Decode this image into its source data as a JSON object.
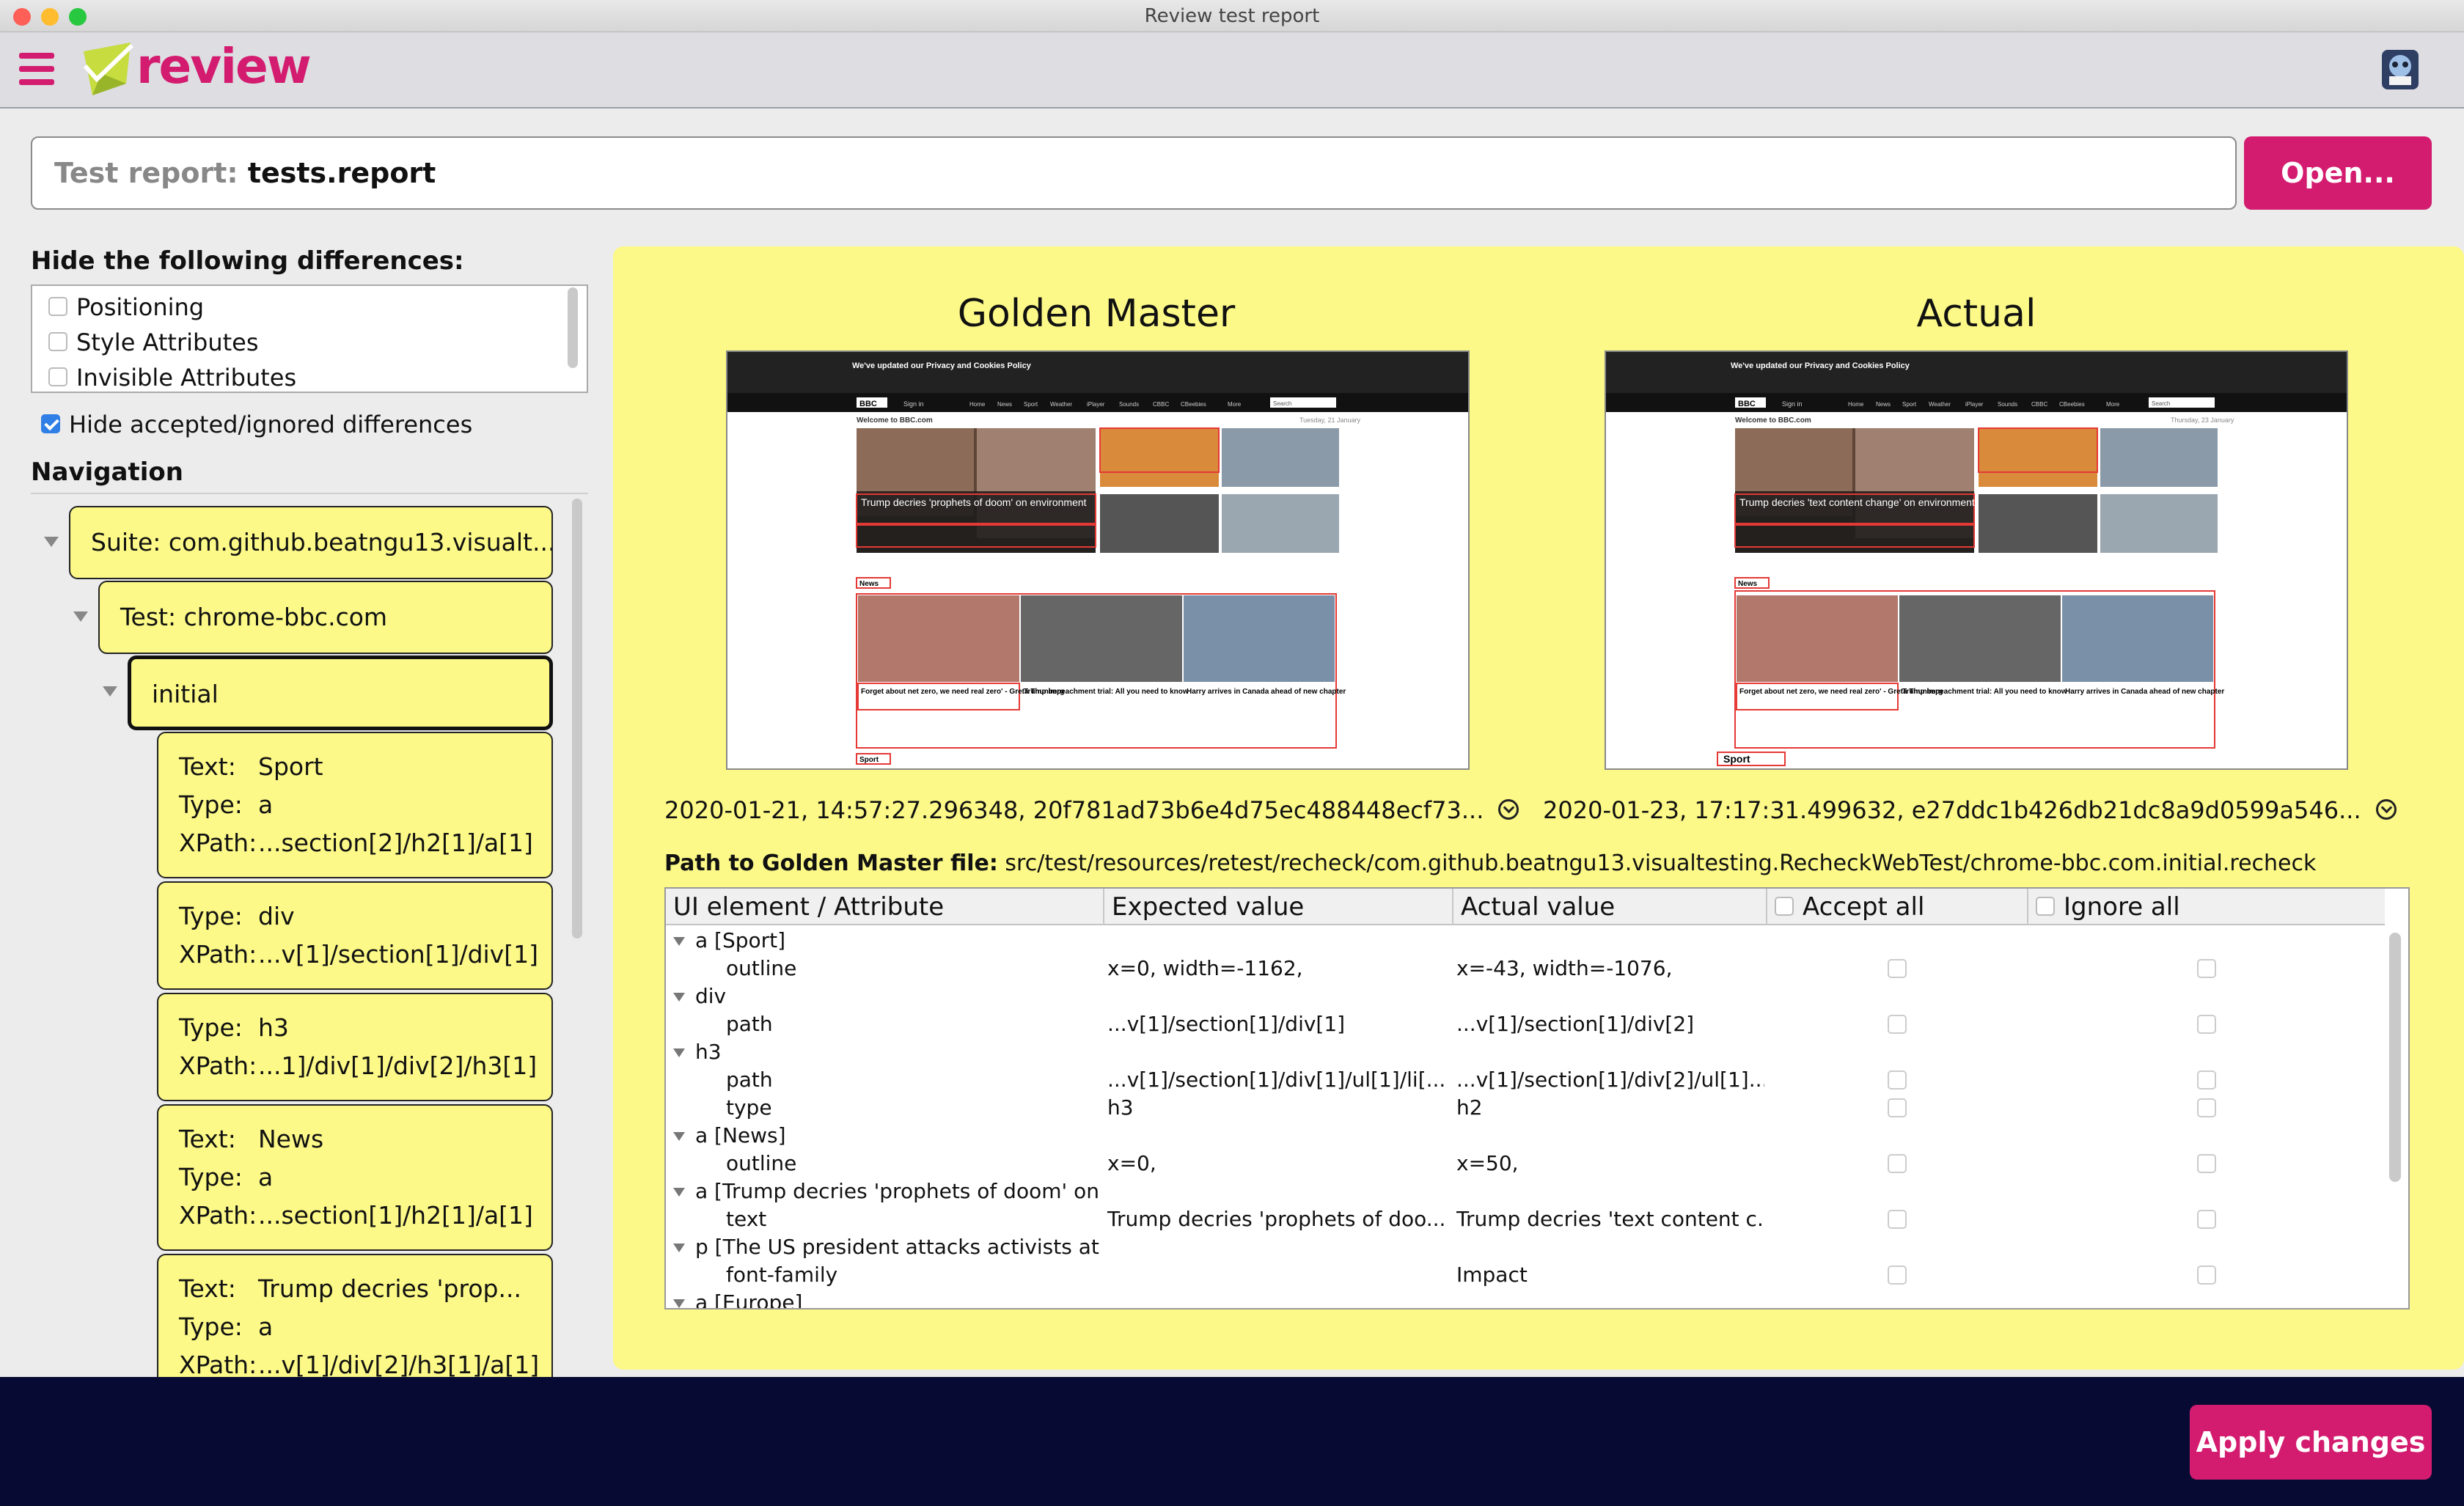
{
  "window": {
    "title": "Review test report"
  },
  "header": {
    "logo_text": "review",
    "brand_color": "#d31c6f",
    "logo_icon": "review-logo-icon",
    "avatar_icon": "user-avatar-icon"
  },
  "report": {
    "label": "Test report:",
    "value": "tests.report",
    "open_label": "Open..."
  },
  "filters": {
    "heading": "Hide the following differences:",
    "items": [
      {
        "label": "Positioning",
        "checked": false
      },
      {
        "label": "Style Attributes",
        "checked": false
      },
      {
        "label": "Invisible Attributes",
        "checked": false
      }
    ],
    "hide_accepted_label": "Hide accepted/ignored differences",
    "hide_accepted_checked": true
  },
  "navigation": {
    "heading": "Navigation",
    "suite": "Suite: com.github.beatngu13.visualt...",
    "test": "Test: chrome-bbc.com",
    "check": "initial",
    "items": [
      {
        "lines": [
          {
            "k": "Text:",
            "v": "Sport"
          },
          {
            "k": "Type:",
            "v": "a"
          },
          {
            "k": "XPath:",
            "v": "...section[2]/h2[1]/a[1]"
          }
        ]
      },
      {
        "lines": [
          {
            "k": "Type:",
            "v": "div"
          },
          {
            "k": "XPath:",
            "v": "...v[1]/section[1]/div[1]"
          }
        ]
      },
      {
        "lines": [
          {
            "k": "Type:",
            "v": "h3"
          },
          {
            "k": "XPath:",
            "v": "...1]/div[1]/div[2]/h3[1]"
          }
        ]
      },
      {
        "lines": [
          {
            "k": "Text:",
            "v": "News"
          },
          {
            "k": "Type:",
            "v": "a"
          },
          {
            "k": "XPath:",
            "v": "...section[1]/h2[1]/a[1]"
          }
        ]
      },
      {
        "lines": [
          {
            "k": "Text:",
            "v": "Trump decries 'prop..."
          },
          {
            "k": "Type:",
            "v": "a"
          },
          {
            "k": "XPath:",
            "v": "...v[1]/div[2]/h3[1]/a[1]"
          }
        ]
      }
    ]
  },
  "comparison": {
    "golden_title": "Golden Master",
    "actual_title": "Actual",
    "golden_info": "2020-01-21, 14:57:27.296348, 20f781ad73b6e4d75ec488448ecf73...",
    "actual_info": "2020-01-23, 17:17:31.499632, e27ddc1b426db21dc8a9d0599a546...",
    "path_label": "Path to Golden Master file:",
    "path_value": "src/test/resources/retest/recheck/com.github.beatngu13.visualtesting.RecheckWebTest/chrome-bbc.com.initial.recheck"
  },
  "screenshot": {
    "banner_title": "We've updated our Privacy and Cookies Policy",
    "bbc_logo": "BBC",
    "sign_in": "Sign in",
    "nav_items": [
      "Home",
      "News",
      "Sport",
      "Weather",
      "iPlayer",
      "Sounds",
      "CBBC",
      "CBeebies",
      "More"
    ],
    "search": "Search",
    "welcome": "Welcome to BBC.com",
    "golden_date": "Tuesday, 21 January",
    "actual_date": "Thursday, 23 January",
    "golden_headline": "Trump decries 'prophets of doom' on environment",
    "actual_headline": "Trump decries 'text content change' on environment",
    "news_label": "News",
    "sport_label": "Sport",
    "story1": "Forget about net zero, we need real zero' - Greta Thunberg",
    "story2": "Trump impeachment trial: All you need to know",
    "story3": "Harry arrives in Canada ahead of new chapter"
  },
  "table": {
    "headers": [
      "UI element / Attribute",
      "Expected value",
      "Actual value",
      "Accept all",
      "Ignore all"
    ],
    "rows": [
      {
        "group": true,
        "name": "a [Sport]"
      },
      {
        "group": false,
        "name": "outline",
        "expected": "x=0, width=-1162,",
        "actual": "x=-43, width=-1076,"
      },
      {
        "group": true,
        "name": "div"
      },
      {
        "group": false,
        "name": "path",
        "expected": "...v[1]/section[1]/div[1]",
        "actual": "...v[1]/section[1]/div[2]"
      },
      {
        "group": true,
        "name": "h3"
      },
      {
        "group": false,
        "name": "path",
        "expected": "...v[1]/section[1]/div[1]/ul[1]/li[...",
        "actual": "...v[1]/section[1]/div[2]/ul[1]..."
      },
      {
        "group": false,
        "name": "type",
        "expected": "h3",
        "actual": "h2"
      },
      {
        "group": true,
        "name": "a [News]"
      },
      {
        "group": false,
        "name": "outline",
        "expected": "x=0,",
        "actual": "x=50,"
      },
      {
        "group": true,
        "name": "a [Trump decries 'prophets of doom' on e"
      },
      {
        "group": false,
        "name": "text",
        "expected": "Trump decries 'prophets of doo...",
        "actual": "Trump decries 'text content c..."
      },
      {
        "group": true,
        "name": "p [The US president attacks activists at th"
      },
      {
        "group": false,
        "name": "font-family",
        "expected": "",
        "actual": "Impact"
      },
      {
        "group": true,
        "name": "a [Europe]"
      }
    ]
  },
  "footer": {
    "apply_label": "Apply changes"
  }
}
